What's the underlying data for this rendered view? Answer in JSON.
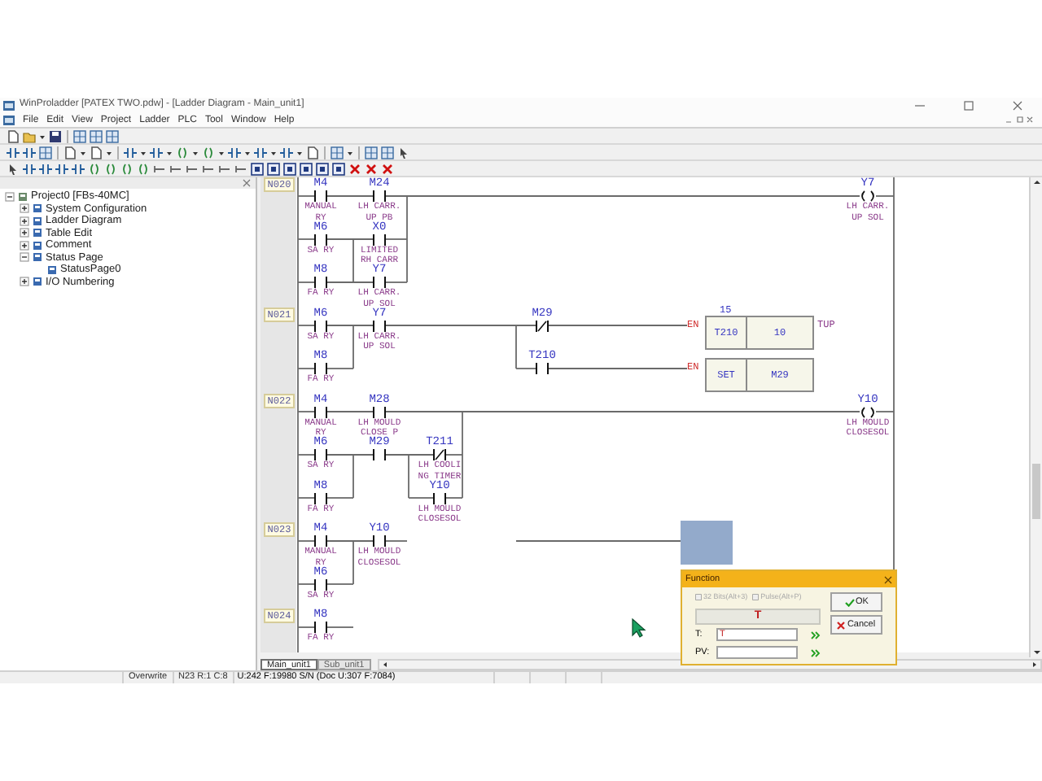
{
  "window": {
    "title": "WinProladder [PATEX TWO.pdw] - [Ladder Diagram - Main_unit1]"
  },
  "menu": [
    "File",
    "Edit",
    "View",
    "Project",
    "Ladder",
    "PLC",
    "Tool",
    "Window",
    "Help"
  ],
  "tree": {
    "label": "Project0 [FBs-40MC]",
    "expanded": true,
    "children": [
      {
        "label": "System Configuration",
        "expanded": false
      },
      {
        "label": "Ladder Diagram",
        "expanded": false
      },
      {
        "label": "Table Edit",
        "expanded": false
      },
      {
        "label": "Comment",
        "expanded": false
      },
      {
        "label": "Status Page",
        "expanded": true,
        "children": [
          {
            "label": "StatusPage0"
          }
        ]
      },
      {
        "label": "I/O Numbering",
        "expanded": false
      }
    ]
  },
  "rungs": [
    {
      "label": "N020",
      "elements": [
        {
          "kind": "contact",
          "address": "M4",
          "comment": [
            "MANUAL",
            "RY"
          ]
        },
        {
          "kind": "contact",
          "address": "M24",
          "comment": [
            "LH CARR.",
            "UP PB"
          ]
        },
        {
          "kind": "coil",
          "address": "Y7",
          "comment": [
            "LH CARR.",
            "UP SOL"
          ]
        },
        {
          "kind": "contact",
          "address": "M6",
          "comment": [
            "SA RY"
          ]
        },
        {
          "kind": "contact",
          "address": "X0",
          "comment": [
            "LIMITED",
            "RH CARR"
          ]
        },
        {
          "kind": "contact",
          "address": "M8",
          "comment": [
            "FA RY"
          ]
        },
        {
          "kind": "contact",
          "address": "Y7",
          "comment": [
            "LH CARR.",
            "UP SOL"
          ]
        }
      ]
    },
    {
      "label": "N021",
      "elements": [
        {
          "kind": "contact",
          "address": "M6",
          "comment": [
            "SA RY"
          ]
        },
        {
          "kind": "contact",
          "address": "Y7",
          "comment": [
            "LH CARR.",
            "UP SOL"
          ]
        },
        {
          "kind": "nc_contact",
          "address": "M29"
        },
        {
          "kind": "function",
          "input": "EN",
          "above": "15",
          "name": "T210",
          "operand": "10",
          "output": "TUP"
        },
        {
          "kind": "contact",
          "address": "M8",
          "comment": [
            "FA RY"
          ]
        },
        {
          "kind": "contact",
          "address": "T210"
        },
        {
          "kind": "function",
          "input": "EN",
          "name": "SET",
          "operand": "M29"
        }
      ]
    },
    {
      "label": "N022",
      "elements": [
        {
          "kind": "contact",
          "address": "M4",
          "comment": [
            "MANUAL",
            "RY"
          ]
        },
        {
          "kind": "contact",
          "address": "M28",
          "comment": [
            "LH MOULD",
            "CLOSE P"
          ]
        },
        {
          "kind": "coil",
          "address": "Y10",
          "comment": [
            "LH MOULD",
            "CLOSESOL"
          ]
        },
        {
          "kind": "contact",
          "address": "M6",
          "comment": [
            "SA RY"
          ]
        },
        {
          "kind": "contact",
          "address": "M29"
        },
        {
          "kind": "nc_contact",
          "address": "T211",
          "comment": [
            "LH COOLI",
            "NG TIMER"
          ]
        },
        {
          "kind": "contact",
          "address": "M8",
          "comment": [
            "FA RY"
          ]
        },
        {
          "kind": "contact",
          "address": "Y10",
          "comment": [
            "LH MOULD",
            "CLOSESOL"
          ]
        }
      ]
    },
    {
      "label": "N023",
      "elements": [
        {
          "kind": "contact",
          "address": "M4",
          "comment": [
            "MANUAL",
            "RY"
          ]
        },
        {
          "kind": "contact",
          "address": "Y10",
          "comment": [
            "LH MOULD",
            "CLOSESOL"
          ]
        },
        {
          "kind": "contact",
          "address": "M6",
          "comment": [
            "SA RY"
          ]
        }
      ]
    },
    {
      "label": "N024",
      "elements": [
        {
          "kind": "contact",
          "address": "M8",
          "comment": [
            "FA RY"
          ]
        }
      ]
    }
  ],
  "tabs": [
    {
      "label": "Main_unit1",
      "selected": true
    },
    {
      "label": "Sub_unit1",
      "selected": false
    }
  ],
  "status_bar": [
    "Overwrite",
    "N23 R:1 C:8",
    "U:242 F:19980 S/N (Doc U:307 F:7084)"
  ],
  "dialog": {
    "title": "Function",
    "options": [
      {
        "label": "32 Bits(Alt+3)",
        "checked": false,
        "disabled": true
      },
      {
        "label": "Pulse(Alt+P)",
        "checked": false,
        "disabled": true
      }
    ],
    "function_name": "T",
    "fields": [
      {
        "label": "T:",
        "value": "T"
      },
      {
        "label": "PV:"
      }
    ],
    "buttons": [
      {
        "kind": "ok",
        "label": "OK"
      },
      {
        "kind": "cancel",
        "label": "Cancel"
      }
    ]
  }
}
